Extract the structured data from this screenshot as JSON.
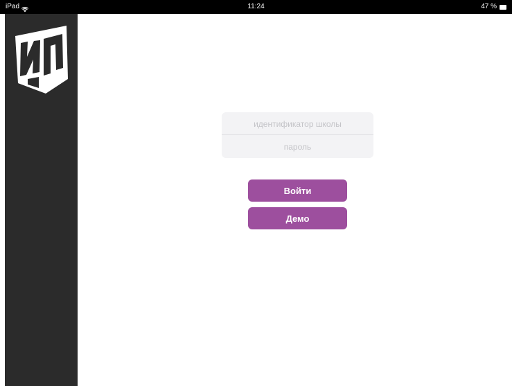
{
  "status_bar": {
    "device": "iPad",
    "wifi_icon": "wifi-icon",
    "time": "11:24",
    "battery": "47 %",
    "battery_icon": "battery-icon"
  },
  "sidebar": {
    "background": "#2b2b2b",
    "logo_icon": "ip-logo-icon"
  },
  "login": {
    "school_id_placeholder": "идентификатор школы",
    "school_id_value": "",
    "password_placeholder": "пароль",
    "password_value": ""
  },
  "buttons": {
    "login_label": "Войти",
    "demo_label": "Демо",
    "accent": "#9d4f9e"
  }
}
